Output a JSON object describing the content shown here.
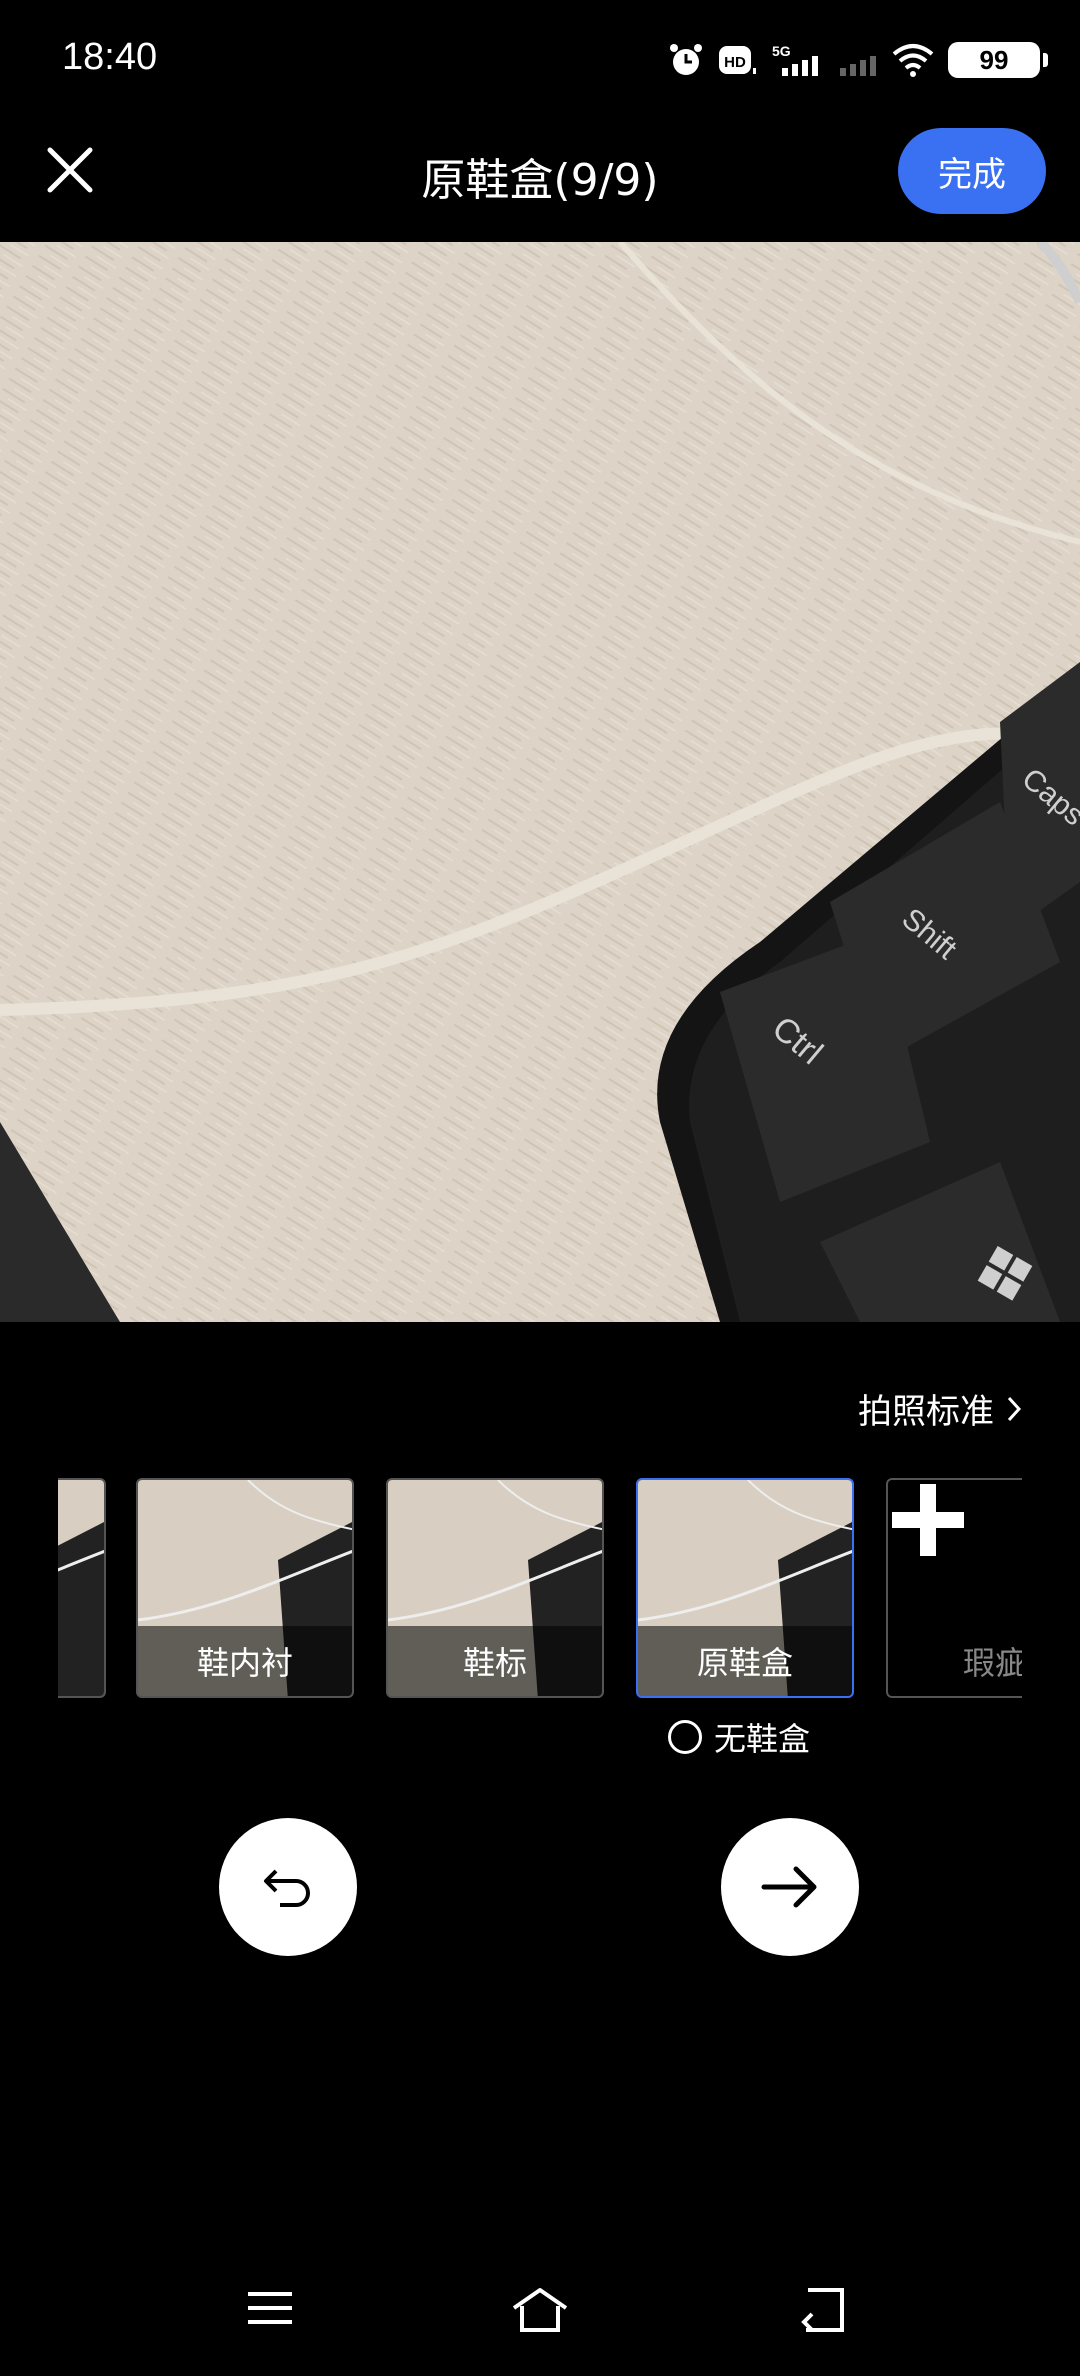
{
  "status_bar": {
    "time": "18:40",
    "icons": [
      "alarm-icon",
      "hd-icon",
      "5g-signal-icon",
      "signal-icon",
      "wifi-icon"
    ],
    "battery": "99"
  },
  "header": {
    "title": "原鞋盒(9/9)",
    "done_label": "完成",
    "close_icon": "close-icon"
  },
  "accent_color": "#3a70f2",
  "photo": {
    "keys": [
      "Caps",
      "Shift",
      "Ctrl"
    ]
  },
  "standard_link": "拍照标准",
  "thumbnails": [
    {
      "label": ""
    },
    {
      "label": "鞋内衬"
    },
    {
      "label": "鞋标"
    },
    {
      "label": "原鞋盒"
    },
    {
      "label": "瑕疵"
    }
  ],
  "no_box_label": "无鞋盒",
  "actions": {
    "undo_icon": "undo-icon",
    "next_icon": "arrow-right-icon"
  },
  "navbar": [
    "menu-icon",
    "home-icon",
    "back-icon"
  ]
}
